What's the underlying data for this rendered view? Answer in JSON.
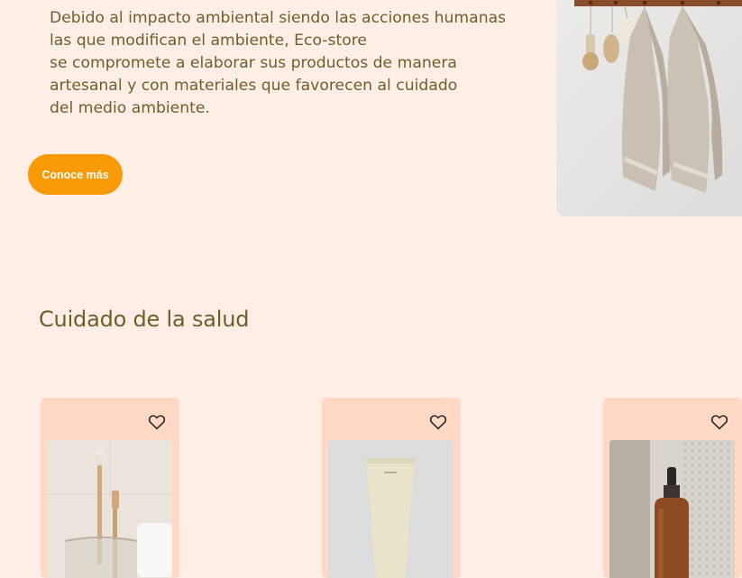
{
  "intro": {
    "lines": [
      "Debido al impacto ambiental siendo las acciones humanas",
      "las que modifican el ambiente, Eco-store",
      "se compromete a elaborar sus productos de manera",
      "artesanal y con materiales que favorecen al cuidado",
      "del medio ambiente."
    ],
    "cta_label": "Conoce más"
  },
  "section": {
    "title": "Cuidado de la salud"
  },
  "products": [
    {
      "image": "bamboo-toothbrushes",
      "favorite_icon": "heart-outline-icon"
    },
    {
      "image": "cream-tube",
      "favorite_icon": "heart-outline-icon"
    },
    {
      "image": "amber-dropper-bottle",
      "favorite_icon": "heart-outline-icon"
    }
  ],
  "colors": {
    "background": "#feeee6",
    "text": "#6e5e2c",
    "accent": "#f89a06",
    "card": "#ffd9c6"
  }
}
